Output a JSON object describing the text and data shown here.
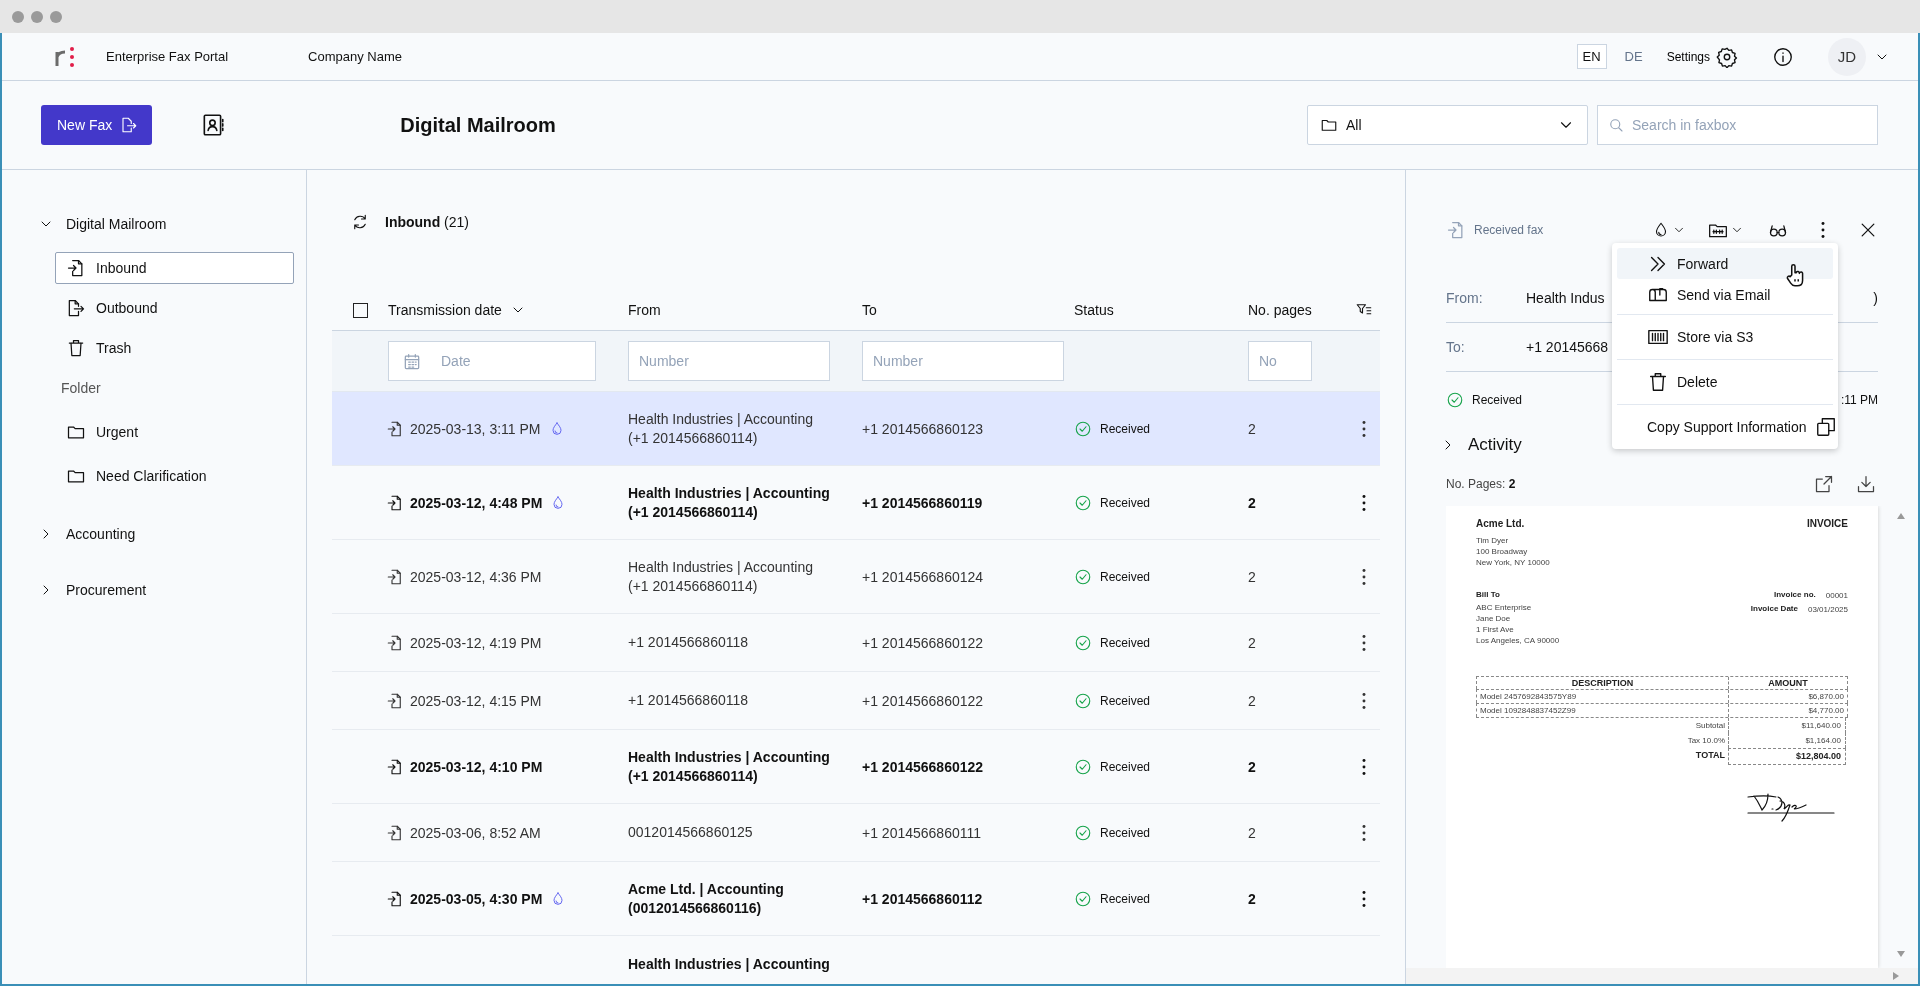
{
  "header": {
    "app_name": "Enterprise Fax Portal",
    "company": "Company Name",
    "languages": [
      {
        "label": "EN",
        "selected": true
      },
      {
        "label": "DE",
        "selected": false
      }
    ],
    "settings": "Settings",
    "avatar": "JD"
  },
  "toolbar": {
    "new_fax": "New Fax",
    "title": "Digital Mailroom",
    "folder_select": "All",
    "search": {
      "placeholder": "Search in faxbox"
    }
  },
  "sidebar": {
    "tree": [
      {
        "label": "Digital Mailroom",
        "expanded": true,
        "children": [
          {
            "kind": "inbound",
            "label": "Inbound",
            "selected": true
          },
          {
            "kind": "outbound",
            "label": "Outbound",
            "selected": false
          },
          {
            "kind": "trash",
            "label": "Trash",
            "selected": false
          },
          {
            "kind": "heading",
            "label": "Folder"
          },
          {
            "kind": "folder",
            "label": "Urgent",
            "selected": false
          },
          {
            "kind": "folder",
            "label": "Need Clarification",
            "selected": false
          }
        ]
      },
      {
        "label": "Accounting",
        "expanded": false
      },
      {
        "label": "Procurement",
        "expanded": false
      }
    ]
  },
  "list": {
    "title": "Inbound",
    "count": "(21)",
    "select_all": {
      "checked": false
    },
    "columns": [
      {
        "label": "Transmission date",
        "sorted": true
      },
      {
        "label": "From",
        "sorted": false
      },
      {
        "label": "To",
        "sorted": false
      },
      {
        "label": "Status",
        "sorted": false
      },
      {
        "label": "No. pages",
        "sorted": false
      }
    ],
    "filters": [
      {
        "placeholder": "Date",
        "kind": "date"
      },
      {
        "placeholder": "Number",
        "kind": "text"
      },
      {
        "placeholder": "Number",
        "kind": "text"
      },
      {
        "kind": "none"
      },
      {
        "placeholder": "No",
        "kind": "text"
      }
    ],
    "rows": [
      {
        "date": "2025-03-13, 3:11 PM",
        "flagged": true,
        "from": "Health Industries | Accounting",
        "from_number": "(+1 2014566860114)",
        "to": "+1 2014566860123",
        "status": "Received",
        "pages": "2",
        "unread": false,
        "selected": true
      },
      {
        "date": "2025-03-12, 4:48 PM",
        "flagged": true,
        "from": "Health Industries | Accounting",
        "from_number": "(+1 2014566860114)",
        "to": "+1 2014566860119",
        "status": "Received",
        "pages": "2",
        "unread": true,
        "selected": false
      },
      {
        "date": "2025-03-12, 4:36 PM",
        "flagged": false,
        "from": "Health Industries | Accounting",
        "from_number": "(+1 2014566860114)",
        "to": "+1 2014566860124",
        "status": "Received",
        "pages": "2",
        "unread": false,
        "selected": false
      },
      {
        "date": "2025-03-12, 4:19 PM",
        "flagged": false,
        "from": "+1 2014566860118",
        "to": "+1 2014566860122",
        "status": "Received",
        "pages": "2",
        "unread": false,
        "selected": false
      },
      {
        "date": "2025-03-12, 4:15 PM",
        "flagged": false,
        "from": "+1 2014566860118",
        "to": "+1 2014566860122",
        "status": "Received",
        "pages": "2",
        "unread": false,
        "selected": false
      },
      {
        "date": "2025-03-12, 4:10 PM",
        "flagged": false,
        "from": "Health Industries | Accounting",
        "from_number": "(+1 2014566860114)",
        "to": "+1 2014566860122",
        "status": "Received",
        "pages": "2",
        "unread": true,
        "selected": false
      },
      {
        "date": "2025-03-06, 8:52 AM",
        "flagged": false,
        "from": "0012014566860125",
        "to": "+1 2014566860111",
        "status": "Received",
        "pages": "2",
        "unread": false,
        "selected": false
      },
      {
        "date": "2025-03-05, 4:30 PM",
        "flagged": true,
        "from": "Acme Ltd. | Accounting",
        "from_number": "(0012014566860116)",
        "to": "+1 2014566860112",
        "status": "Received",
        "pages": "2",
        "unread": true,
        "selected": false
      },
      {
        "flagged": false,
        "from": "Health Industries | Accounting",
        "unread": true,
        "selected": false
      }
    ]
  },
  "detail": {
    "title": "Received fax",
    "from_label": "From:",
    "from_value": "Health Indus",
    "from_value_end": ")",
    "to_label": "To:",
    "to_value": "+1 20145668",
    "status": "Received",
    "time": ":11 PM",
    "activity": "Activity",
    "pages_label": "No. Pages:",
    "pages": "2",
    "menu": [
      {
        "label": "Forward",
        "kind": "forward",
        "hovered": true,
        "divider_before": false
      },
      {
        "label": "Send via Email",
        "kind": "email",
        "hovered": false,
        "divider_before": false
      },
      {
        "label": "Store via S3",
        "kind": "storage",
        "hovered": false,
        "divider_before": true
      },
      {
        "label": "Delete",
        "kind": "delete",
        "hovered": false,
        "divider_before": true
      },
      {
        "label": "Copy Support Information",
        "kind": "copy",
        "hovered": false,
        "divider_before": true
      }
    ],
    "document": {
      "company": "Acme Ltd.",
      "doc_title": "INVOICE",
      "sender": [
        "Tim Dyer",
        "100 Broadway",
        "New York, NY 10000"
      ],
      "bill_to_label": "Bill To",
      "bill_to": [
        "ABC Enterprise",
        "Jane Doe",
        "1 First Ave",
        "Los Angeles, CA 90000"
      ],
      "meta": [
        {
          "label": "Invoice no.",
          "value": "00001"
        },
        {
          "label": "Invoice Date",
          "value": "03/01/2025"
        }
      ],
      "table_headers": [
        "DESCRIPTION",
        "AMOUNT"
      ],
      "items": [
        {
          "description": "Model 2457692843575Y89",
          "amount": "$6,870.00"
        },
        {
          "description": "Model 1092848837452Z99",
          "amount": "$4,770.00"
        }
      ],
      "totals": [
        {
          "label": "Subtotal",
          "value": "$11,640.00",
          "kind": "sub"
        },
        {
          "label": "Tax 10.0%",
          "value": "$1,164.00",
          "kind": "sub"
        },
        {
          "label": "TOTAL",
          "value": "$12,804.00",
          "kind": "total"
        }
      ]
    }
  }
}
